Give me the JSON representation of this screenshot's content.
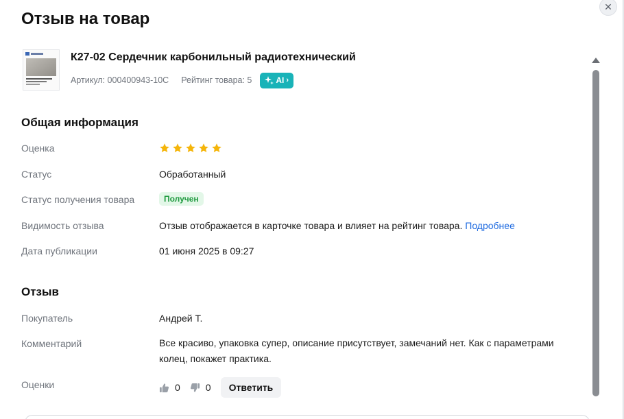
{
  "modal": {
    "title": "Отзыв на товар",
    "close_icon": "close-icon"
  },
  "product": {
    "title": "К27-02 Сердечник карбонильный радиотехнический",
    "article": "Артикул: 000400943-10С",
    "rating": "Рейтинг товара: 5",
    "ai_label": "AI",
    "ai_icon": "sparkle-icon"
  },
  "general": {
    "title": "Общая информация",
    "rating_label": "Оценка",
    "rating_value": 5,
    "status_label": "Статус",
    "status_value": "Обработанный",
    "receipt_label": "Статус получения товара",
    "receipt_value": "Получен",
    "visibility_label": "Видимость отзыва",
    "visibility_value": "Отзыв отображается в карточке товара и влияет на рейтинг товара.",
    "visibility_link": "Подробнее",
    "date_label": "Дата публикации",
    "date_value": "01 июня 2025 в 09:27"
  },
  "review": {
    "title": "Отзыв",
    "buyer_label": "Покупатель",
    "buyer_value": "Андрей Т.",
    "comment_label": "Комментарий",
    "comment_value": "Все красиво, упаковка супер, описание присутствует, замечаний нет. Как с параметрами колец, покажет практика.",
    "votes_label": "Оценки",
    "likes": "0",
    "dislikes": "0",
    "reply_label": "Ответить"
  },
  "colors": {
    "accent_teal": "#19b3b8",
    "star": "#f5b50a",
    "status_green": "#1f9a3f",
    "link": "#1f6be0"
  }
}
